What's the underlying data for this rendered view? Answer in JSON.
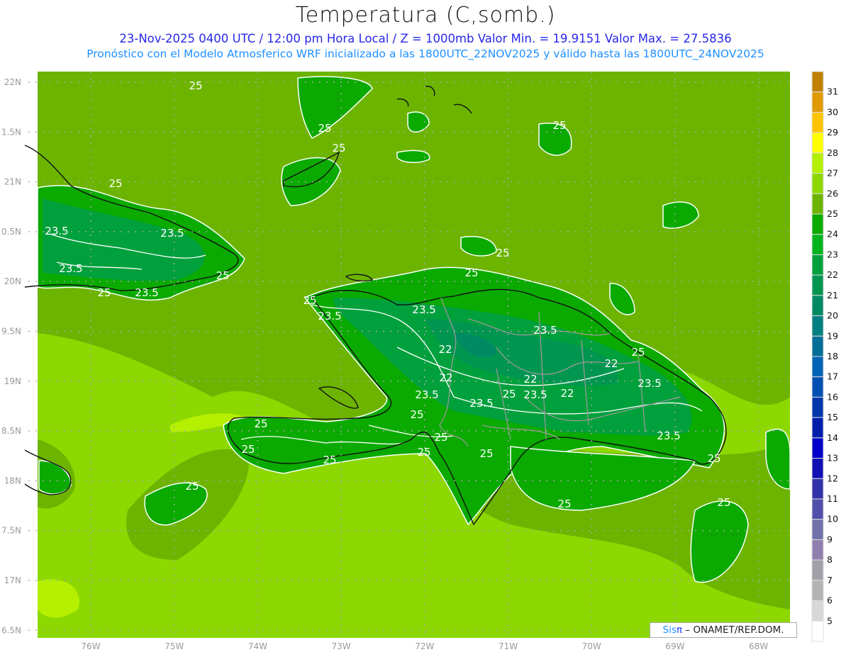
{
  "header": {
    "title": "Temperatura (C,somb.)",
    "subtitle1": "23-Nov-2025 0400 UTC / 12:00 pm Hora Local / Z = 1000mb   Valor Min. = 19.9151   Valor Max. = 27.5836",
    "subtitle2": "Pronóstico con el Modelo Atmosferico WRF inicializado a las 1800UTC_22NOV2025 y válido hasta las  1800UTC_24NOV2025"
  },
  "axes": {
    "lon_labels": [
      "76W",
      "75W",
      "74W",
      "73W",
      "72W",
      "71W",
      "70W",
      "69W",
      "68W"
    ],
    "lat_labels": [
      "22N",
      "1.5N",
      "21N",
      "0.5N",
      "20N",
      "9.5N",
      "19N",
      "8.5N",
      "18N",
      "7.5N",
      "17N",
      "6.5N"
    ]
  },
  "colorbar": {
    "labels": [
      "31",
      "30",
      "29",
      "28",
      "27",
      "26",
      "25",
      "24",
      "23",
      "22",
      "21",
      "20",
      "19",
      "18",
      "17",
      "16",
      "15",
      "14",
      "13",
      "12",
      "11",
      "10",
      "9",
      "8",
      "7",
      "6",
      "5"
    ],
    "colors": [
      "#c08000",
      "#e09a00",
      "#ffc400",
      "#ffff00",
      "#b4f000",
      "#8cd800",
      "#6cb400",
      "#0aaa00",
      "#00b41e",
      "#00a03c",
      "#009650",
      "#008a64",
      "#008080",
      "#006e96",
      "#0064b4",
      "#0050b4",
      "#0037aa",
      "#001eaa",
      "#0000c8",
      "#1010b4",
      "#3232aa",
      "#5050aa",
      "#7070aa",
      "#9080b0",
      "#a0a0a8",
      "#b4b4b4",
      "#d7d7d7",
      "#ffffff"
    ]
  },
  "map": {
    "contour_labels": [
      "25",
      "25",
      "25",
      "25",
      "23.5",
      "23.5",
      "23.5",
      "25",
      "23.5",
      "25",
      "25",
      "25",
      "25",
      "25",
      "23.5",
      "23.5",
      "23.5",
      "22",
      "22",
      "22",
      "22",
      "25",
      "23.5",
      "23.5",
      "25",
      "23.5",
      "22",
      "23.5",
      "25",
      "25",
      "25",
      "25",
      "25",
      "25",
      "25",
      "23.5",
      "25",
      "25",
      "25",
      "25"
    ]
  },
  "credit": {
    "sis": "Sis",
    "pi": "π",
    "text": " –  ONAMET/REP.DOM."
  }
}
